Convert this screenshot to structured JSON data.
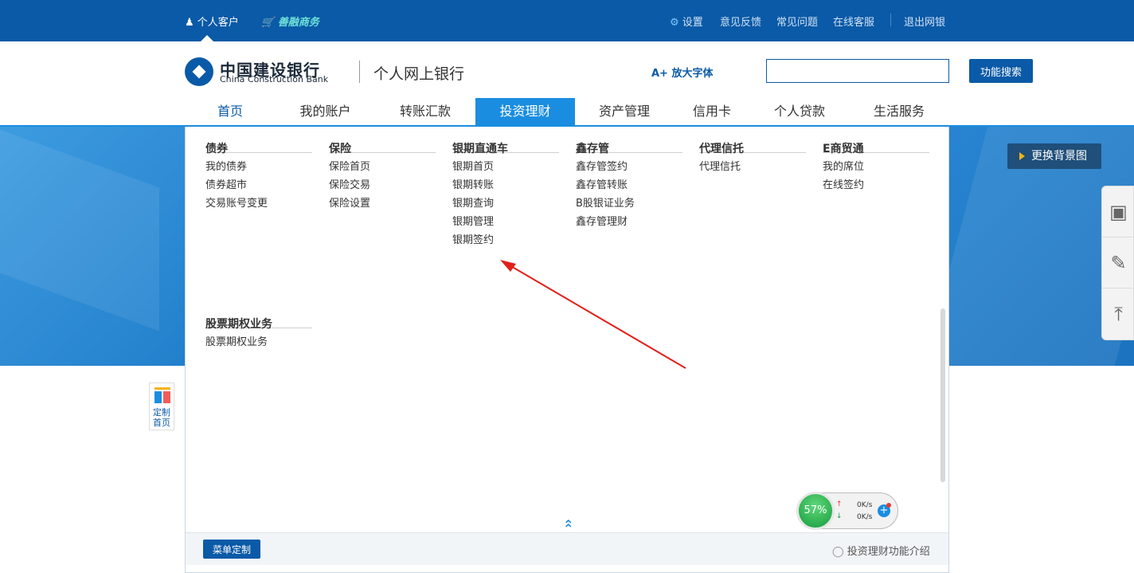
{
  "topbar": {
    "personal": "个人客户",
    "commerce": "善融商务",
    "settings": "设置",
    "feedback": "意见反馈",
    "faq": "常见问题",
    "service": "在线客服",
    "logout": "退出网银"
  },
  "header": {
    "logo_cn": "中国建设银行",
    "logo_en": "China Construction Bank",
    "site_title": "个人网上银行",
    "bigfont": "放大字体",
    "search_value": "",
    "search_button": "功能搜索"
  },
  "nav": [
    "首页",
    "我的账户",
    "转账汇款",
    "投资理财",
    "资产管理",
    "信用卡",
    "个人贷款",
    "生活服务"
  ],
  "banner": {
    "change_bg": "更换背景图"
  },
  "menu": {
    "columns": [
      {
        "head": "债券",
        "items": [
          "我的债券",
          "债券超市",
          "交易账号变更"
        ]
      },
      {
        "head": "保险",
        "items": [
          "保险首页",
          "保险交易",
          "保险设置"
        ]
      },
      {
        "head": "银期直通车",
        "items": [
          "银期首页",
          "银期转账",
          "银期查询",
          "银期管理",
          "银期签约"
        ]
      },
      {
        "head": "鑫存管",
        "items": [
          "鑫存管签约",
          "鑫存管转账",
          "B股银证业务",
          "鑫存管理财"
        ]
      },
      {
        "head": "代理信托",
        "items": [
          "代理信托"
        ]
      },
      {
        "head": "E商贸通",
        "items": [
          "我的席位",
          "在线签约"
        ]
      },
      {
        "head": "股票期权业务",
        "items": [
          "股票期权业务"
        ]
      }
    ],
    "custom_button": "菜单定制",
    "intro": "投资理财功能介绍",
    "collapse_icon": "double-chevron-up"
  },
  "custom_home": {
    "line1": "定制",
    "line2": "首页"
  },
  "speed": {
    "percent": "57%",
    "up": "0K/s",
    "down": "0K/s"
  },
  "colors": {
    "primary": "#0a5aa7",
    "accent": "#1a8de0",
    "annotation": "#e0201a"
  }
}
